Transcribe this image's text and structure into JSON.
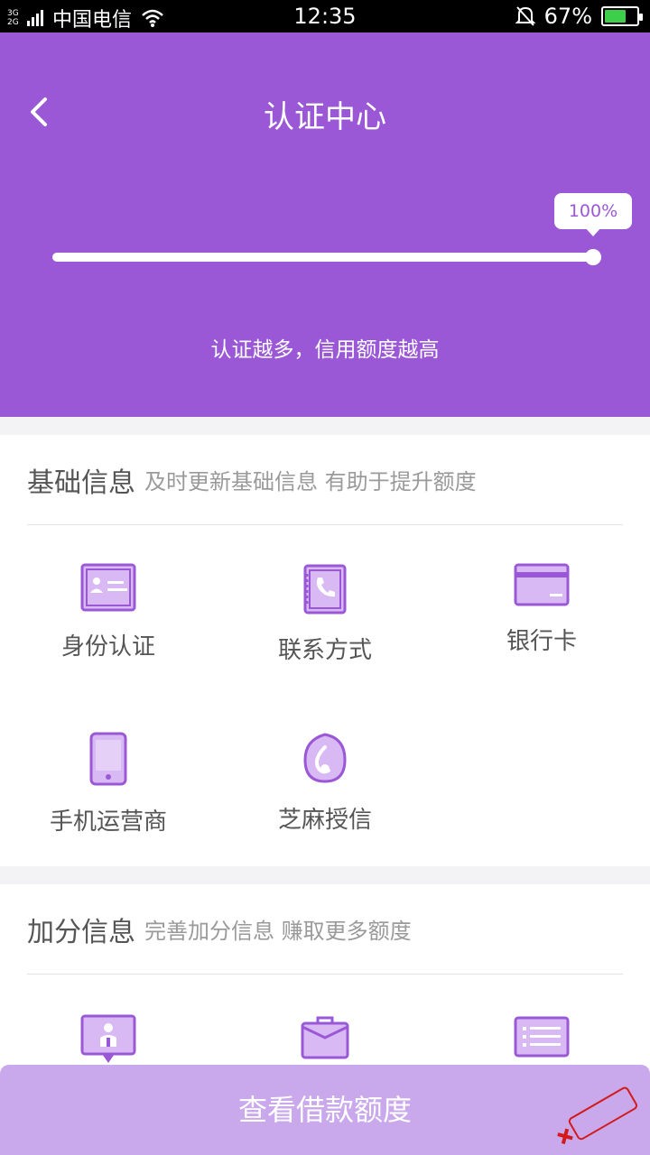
{
  "status_bar": {
    "network": "3G\n2G",
    "carrier": "中国电信",
    "time": "12:35",
    "battery": "67%",
    "battery_level": 0.67
  },
  "header": {
    "title": "认证中心",
    "progress_label": "100%",
    "progress": 1.0,
    "slogan": "认证越多，信用额度越高"
  },
  "basic": {
    "title": "基础信息",
    "subtitle": "及时更新基础信息 有助于提升额度",
    "items": [
      {
        "label": "身份认证",
        "icon": "id-card-icon"
      },
      {
        "label": "联系方式",
        "icon": "contacts-book-icon"
      },
      {
        "label": "银行卡",
        "icon": "bank-card-icon"
      },
      {
        "label": "手机运营商",
        "icon": "mobile-phone-icon"
      },
      {
        "label": "芝麻授信",
        "icon": "sesame-credit-icon"
      }
    ]
  },
  "bonus": {
    "title": "加分信息",
    "subtitle": "完善加分信息 赚取更多额度",
    "items": [
      {
        "icon": "profile-badge-icon"
      },
      {
        "icon": "briefcase-icon"
      },
      {
        "icon": "list-document-icon"
      }
    ]
  },
  "cta_label": "查看借款额度",
  "colors": {
    "primary": "#9b58d6",
    "icon_fill": "#d8b9f4",
    "cta": "#c9a8ec"
  }
}
